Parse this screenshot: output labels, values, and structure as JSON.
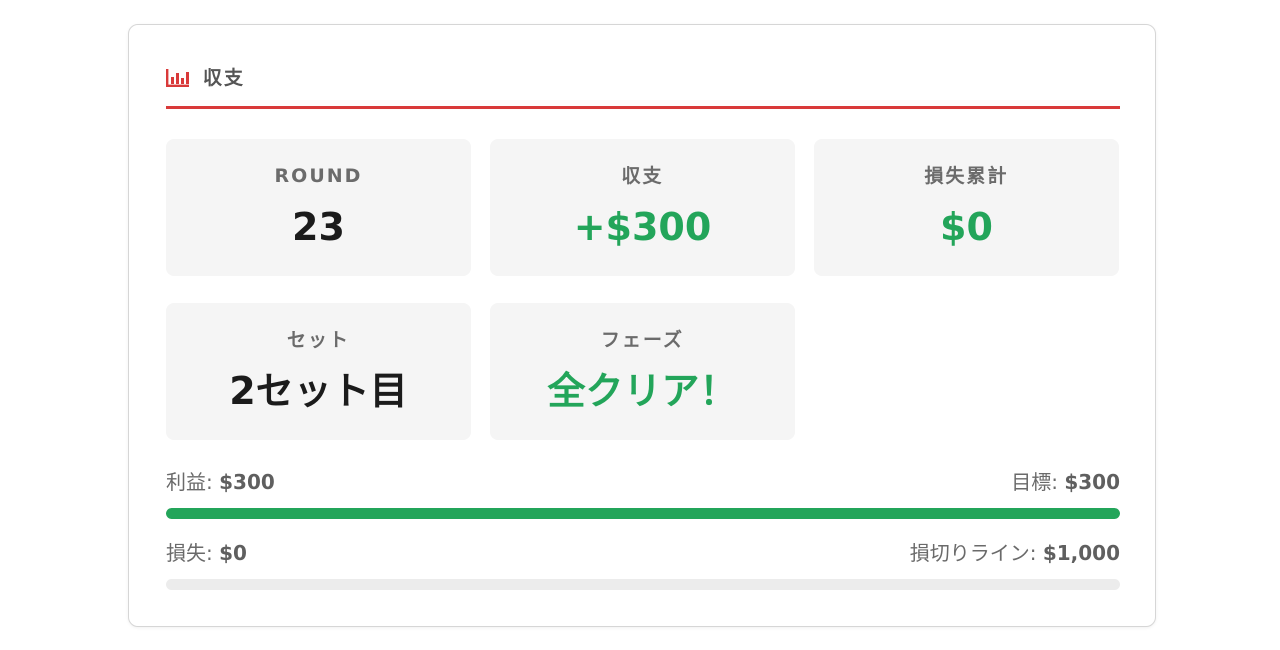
{
  "header": {
    "icon": "bar-chart-icon",
    "title": "収支",
    "accent_color": "#d93a3a"
  },
  "stats": [
    {
      "label": "ROUND",
      "value": "23",
      "color": "#1b1b1b"
    },
    {
      "label": "収支",
      "value": "+$300",
      "color": "#23a55a"
    },
    {
      "label": "損失累計",
      "value": "$0",
      "color": "#23a55a"
    },
    {
      "label": "セット",
      "value": "2セット目",
      "color": "#1b1b1b"
    },
    {
      "label": "フェーズ",
      "value": "全クリア！",
      "color": "#23a55a"
    }
  ],
  "profit_bar": {
    "left_label": "利益: ",
    "left_value": "$300",
    "right_label": "目標: ",
    "right_value": "$300",
    "progress": 1.0,
    "color": "#23a55a"
  },
  "loss_bar": {
    "left_label": "損失: ",
    "left_value": "$0",
    "right_label": "損切りライン: ",
    "right_value": "$1,000",
    "progress": 0.0,
    "color": "#d93a3a"
  }
}
